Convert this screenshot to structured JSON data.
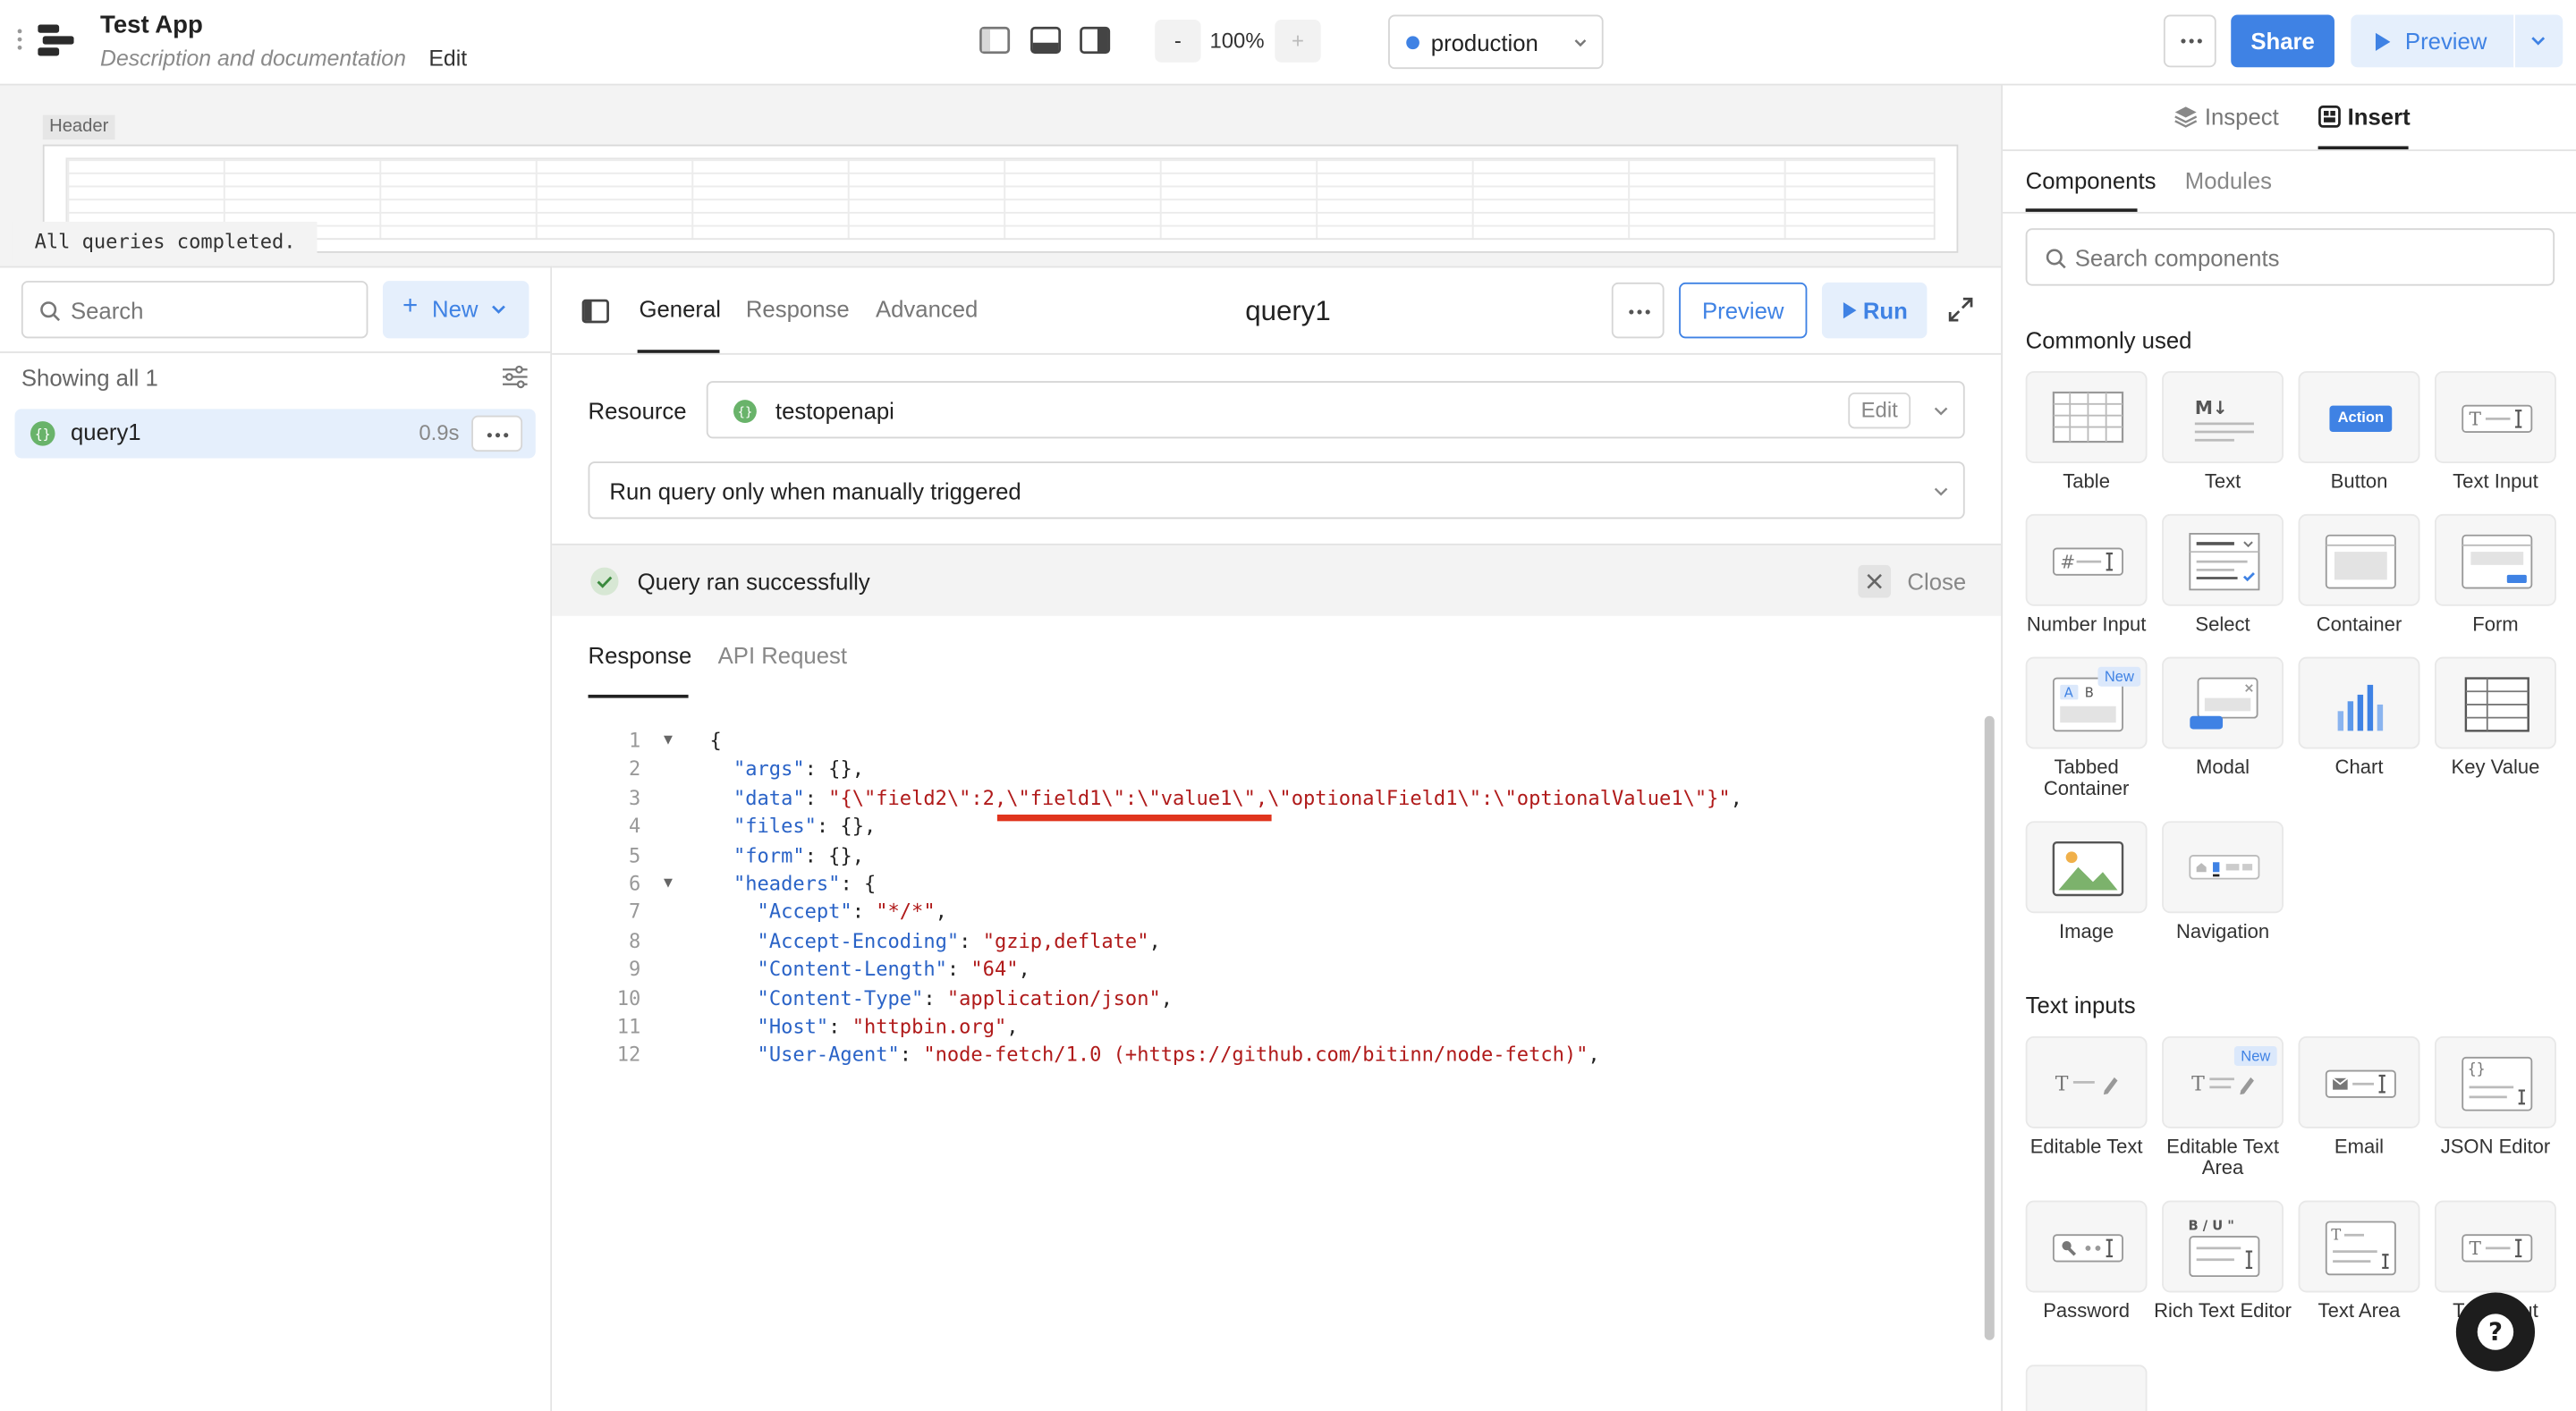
{
  "app": {
    "title": "Test App",
    "description": "Description and documentation",
    "edit_label": "Edit"
  },
  "toolbar": {
    "zoom_minus": "-",
    "zoom_level": "100%",
    "zoom_plus": "+",
    "environment": "production",
    "share_label": "Share",
    "preview_label": "Preview"
  },
  "canvas": {
    "header_tag": "Header",
    "toast": "All queries completed."
  },
  "query_list": {
    "search_placeholder": "Search",
    "new_label": "New",
    "showing": "Showing all 1",
    "items": [
      {
        "name": "query1",
        "time": "0.9s"
      }
    ]
  },
  "editor": {
    "tabs": [
      "General",
      "Response",
      "Advanced"
    ],
    "title": "query1",
    "preview_label": "Preview",
    "run_label": "Run",
    "resource_label": "Resource",
    "resource_name": "testopenapi",
    "resource_edit": "Edit",
    "trigger_mode": "Run query only when manually triggered",
    "status_text": "Query ran successfully",
    "close_label": "Close",
    "response_tabs": [
      "Response",
      "API Request"
    ]
  },
  "code_lines": [
    {
      "n": "1",
      "fold": true,
      "html": "{"
    },
    {
      "n": "2",
      "fold": false,
      "html": "  <span class=\"k\">\"args\"</span>: {},"
    },
    {
      "n": "3",
      "fold": false,
      "html": "  <span class=\"k\">\"data\"</span>: <span class=\"s\">\"{\\\"field2\\\":2,\\\"field1\\\":\\\"value1\\\",\\\"optionalField1\\\":\\\"optionalValue1\\\"}\"</span>,"
    },
    {
      "n": "4",
      "fold": false,
      "html": "  <span class=\"k\">\"files\"</span>: {},"
    },
    {
      "n": "5",
      "fold": false,
      "html": "  <span class=\"k\">\"form\"</span>: {},"
    },
    {
      "n": "6",
      "fold": true,
      "html": "  <span class=\"k\">\"headers\"</span>: {"
    },
    {
      "n": "7",
      "fold": false,
      "html": "    <span class=\"k\">\"Accept\"</span>: <span class=\"s\">\"*/*\"</span>,"
    },
    {
      "n": "8",
      "fold": false,
      "html": "    <span class=\"k\">\"Accept-Encoding\"</span>: <span class=\"s\">\"gzip,deflate\"</span>,"
    },
    {
      "n": "9",
      "fold": false,
      "html": "    <span class=\"k\">\"Content-Length\"</span>: <span class=\"s\">\"64\"</span>,"
    },
    {
      "n": "10",
      "fold": false,
      "html": "    <span class=\"k\">\"Content-Type\"</span>: <span class=\"s\">\"application/json\"</span>,"
    },
    {
      "n": "11",
      "fold": false,
      "html": "    <span class=\"k\">\"Host\"</span>: <span class=\"s\">\"httpbin.org\"</span>,"
    },
    {
      "n": "12",
      "fold": false,
      "html": "    <span class=\"k\">\"User-Agent\"</span>: <span class=\"s\">\"node-fetch/1.0 (+https://github.com/bitinn/node-fetch)\"</span>,"
    }
  ],
  "right_panel": {
    "tab_inspect": "Inspect",
    "tab_insert": "Insert",
    "sub_components": "Components",
    "sub_modules": "Modules",
    "search_placeholder": "Search components",
    "section_common": "Commonly used",
    "section_text_inputs": "Text inputs",
    "action_badge": "Action",
    "common": [
      {
        "label": "Table",
        "icon": "table-icon"
      },
      {
        "label": "Text",
        "icon": "text-icon"
      },
      {
        "label": "Button",
        "icon": "button-icon"
      },
      {
        "label": "Text Input",
        "icon": "text-input-icon"
      },
      {
        "label": "Number Input",
        "icon": "number-input-icon"
      },
      {
        "label": "Select",
        "icon": "select-icon"
      },
      {
        "label": "Container",
        "icon": "container-icon"
      },
      {
        "label": "Form",
        "icon": "form-icon"
      },
      {
        "label": "Tabbed Container",
        "icon": "tabbed-container-icon",
        "badge": "New"
      },
      {
        "label": "Modal",
        "icon": "modal-icon"
      },
      {
        "label": "Chart",
        "icon": "chart-icon"
      },
      {
        "label": "Key Value",
        "icon": "key-value-icon"
      },
      {
        "label": "Image",
        "icon": "image-icon"
      },
      {
        "label": "Navigation",
        "icon": "navigation-icon"
      }
    ],
    "text_inputs": [
      {
        "label": "Editable Text",
        "icon": "editable-text-icon"
      },
      {
        "label": "Editable Text Area",
        "icon": "editable-text-area-icon",
        "badge": "New"
      },
      {
        "label": "Email",
        "icon": "email-icon"
      },
      {
        "label": "JSON Editor",
        "icon": "json-editor-icon"
      },
      {
        "label": "Password",
        "icon": "password-icon"
      },
      {
        "label": "Rich Text Editor",
        "icon": "rich-text-editor-icon"
      },
      {
        "label": "Text Area",
        "icon": "text-area-icon"
      },
      {
        "label": "Text Input",
        "icon": "text-input-icon"
      }
    ]
  }
}
